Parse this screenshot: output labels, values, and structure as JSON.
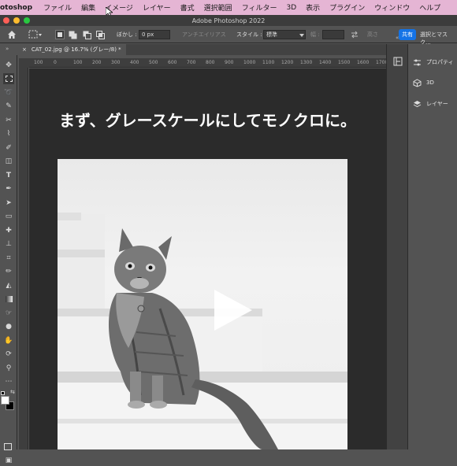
{
  "menubar": {
    "app_name": "otoshop",
    "items": [
      "ファイル",
      "編集",
      "イメージ",
      "レイヤー",
      "書式",
      "選択範囲",
      "フィルター",
      "3D",
      "表示",
      "プラグイン",
      "ウィンドウ",
      "ヘルプ"
    ]
  },
  "window": {
    "title": "Adobe Photoshop 2022"
  },
  "options_bar": {
    "feather_label": "ぼかし :",
    "feather_value": "0 px",
    "antialias_label": "アンチエイリアス",
    "style_label": "スタイル :",
    "style_value": "標準",
    "width_label": "幅 :",
    "height_label": "高さ",
    "share_label": "共有",
    "select_mask_label": "選択とマスク..."
  },
  "document": {
    "tab_title": "CAT_02.jpg @ 16.7% (グレー/8) *"
  },
  "ruler": {
    "ticks": [
      "100",
      "0",
      "100",
      "200",
      "300",
      "400",
      "500",
      "600",
      "700",
      "800",
      "900",
      "1000",
      "1100",
      "1200",
      "1300",
      "1400",
      "1500",
      "1600",
      "1700"
    ]
  },
  "canvas": {
    "headline": "まず、グレースケールにしてモノクロに。"
  },
  "panels": {
    "items": [
      "プロパティ",
      "3D",
      "レイヤー"
    ]
  },
  "colors": {
    "menubar": "#e5b5d4",
    "accent": "#1473e6",
    "canvas_bg": "#2b2b2b"
  }
}
